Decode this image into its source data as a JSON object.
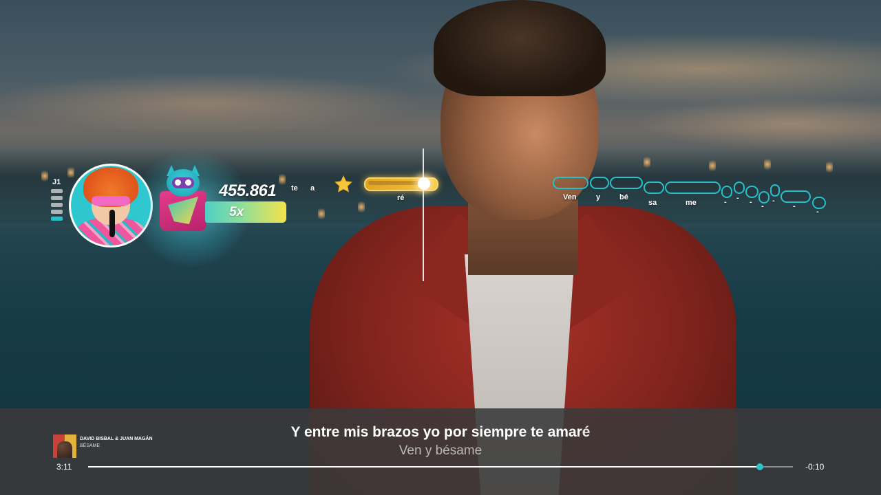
{
  "player": {
    "tag": "J1",
    "level_bars": [
      false,
      false,
      false,
      false,
      true
    ],
    "score": "455.861",
    "multiplier": "5x"
  },
  "lyrics_track": {
    "passed_syllables": [
      "te",
      "a"
    ],
    "current_syllable": "ré",
    "upcoming_syllables": [
      "Ven",
      "y",
      "bé",
      "sa",
      "me",
      "-",
      "-",
      "-",
      "-",
      "-",
      "-",
      "-"
    ]
  },
  "bottom_bar": {
    "artist": "DAVID BISBAL & JUAN MAGÁN",
    "song": "BÉSAME",
    "lyric_sung": "Y entre mis brazos yo por siempre te amar",
    "lyric_rest": "é",
    "lyric_next": "Ven y bésame",
    "elapsed": "3:11",
    "remaining": "-0:10",
    "progress": 0.953
  },
  "icons": [
    "player-avatar-icon",
    "mascot-icon",
    "star-icon",
    "album-cover-icon"
  ],
  "colors": {
    "accent": "#28c0c8",
    "gold": "#f6c844"
  }
}
